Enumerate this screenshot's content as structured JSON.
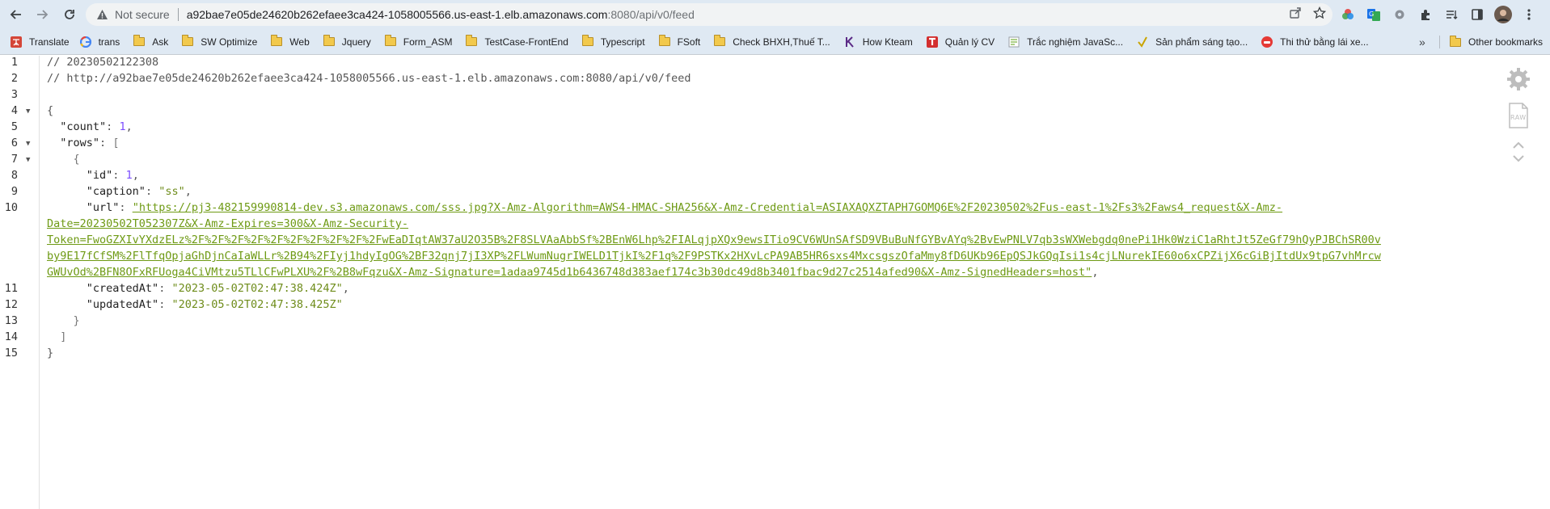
{
  "browser": {
    "security_label": "Not secure",
    "url_host": "a92bae7e05de24620b262efaee3ca424-1058005566.us-east-1.elb.amazonaws.com",
    "url_path": ":8080/api/v0/feed",
    "icons": [
      "back-icon",
      "forward-icon",
      "reload-icon",
      "warning-icon",
      "share-icon",
      "star-icon",
      "extensions-icon",
      "profile-avatar",
      "menu-icon"
    ]
  },
  "bookmarks": {
    "items": [
      {
        "label": "Translate",
        "icon": "translate-icon"
      },
      {
        "label": "trans",
        "icon": "google-icon"
      },
      {
        "label": "Ask",
        "icon": "folder-icon"
      },
      {
        "label": "SW Optimize",
        "icon": "folder-icon"
      },
      {
        "label": "Web",
        "icon": "folder-icon"
      },
      {
        "label": "Jquery",
        "icon": "folder-icon"
      },
      {
        "label": "Form_ASM",
        "icon": "folder-icon"
      },
      {
        "label": "TestCase-FrontEnd",
        "icon": "folder-icon"
      },
      {
        "label": "Typescript",
        "icon": "folder-icon"
      },
      {
        "label": "FSoft",
        "icon": "folder-icon"
      },
      {
        "label": "Check BHXH,Thuế T...",
        "icon": "folder-icon"
      },
      {
        "label": "How Kteam",
        "icon": "kteam-icon"
      },
      {
        "label": "Quản lý CV",
        "icon": "cv-icon"
      },
      {
        "label": "Trắc nghiệm JavaSc...",
        "icon": "quiz-icon"
      },
      {
        "label": "Sản phẩm sáng tạo...",
        "icon": "check-icon"
      },
      {
        "label": "Thi thử bằng lái xe...",
        "icon": "car-icon"
      }
    ],
    "more": "»",
    "other": "Other bookmarks"
  },
  "json_view": {
    "comment_timestamp": "// 20230502122308",
    "comment_url": "// http://a92bae7e05de24620b262efaee3ca424-1058005566.us-east-1.elb.amazonaws.com:8080/api/v0/feed",
    "key_count": "\"count\"",
    "val_count": "1",
    "key_rows": "\"rows\"",
    "key_id": "\"id\"",
    "val_id": "1",
    "key_caption": "\"caption\"",
    "val_caption": "\"ss\"",
    "key_url": "\"url\"",
    "url_line1": "\"https://pj3-482159990814-dev.s3.amazonaws.com/sss.jpg?X-Amz-Algorithm=AWS4-HMAC-SHA256&X-Amz-Credential=ASIAXAQXZTAPH7GOMQ6E%2F20230502%2Fus-east-1%2Fs3%2Faws4_request&X-Amz-",
    "url_line2": "Date=20230502T052307Z&X-Amz-Expires=300&X-Amz-Security-",
    "url_line3": "Token=FwoGZXIvYXdzELz%2F%2F%2F%2F%2F%2F%2F%2F%2F%2FwEaDIqtAW37aU2O35B%2F8SLVAaAbbSf%2BEnW6Lhp%2FIALqjpXQx9ewsITio9CV6WUnSAfSD9VBuBuNfGYBvAYq%2BvEwPNLV7qb3sWXWebgdq0nePi1Hk0WziC1aRhtJt5ZeGf79hQyPJBChSR00v",
    "url_line4": "by9E17fCfSM%2FlTfqOpjaGhDjnCaIaWLLr%2B94%2FIyj1hdyIgOG%2BF32qnj7jI3XP%2FLWumNugrIWELD1TjkI%2F1q%2F9PSTKx2HXvLcPA9AB5HR6sxs4MxcsgszOfaMmy8fD6UKb96EpQSJkGQqIsi1s4cjLNurekIE60o6xCPZijX6cGiBjItdUx9tpG7vhMrcw",
    "url_line5": "GWUvOd%2BFN8OFxRFUoga4CiVMtzu5TLlCFwPLXU%2F%2B8wFqzu&X-Amz-Signature=1adaa9745d1b6436748d383aef174c3b30dc49d8b3401fbac9d27c2514afed90&X-Amz-SignedHeaders=host\"",
    "key_createdAt": "\"createdAt\"",
    "val_createdAt": "\"2023-05-02T02:47:38.424Z\"",
    "key_updatedAt": "\"updatedAt\"",
    "val_updatedAt": "\"2023-05-02T02:47:38.425Z\"",
    "line_numbers": [
      "1",
      "2",
      "3",
      "4",
      "5",
      "6",
      "7",
      "8",
      "9",
      "10",
      "11",
      "12",
      "13",
      "14",
      "15"
    ],
    "side_icons": [
      "settings-gear-icon",
      "raw-icon",
      "expand-collapse-icon"
    ],
    "raw_label": "RAW"
  }
}
